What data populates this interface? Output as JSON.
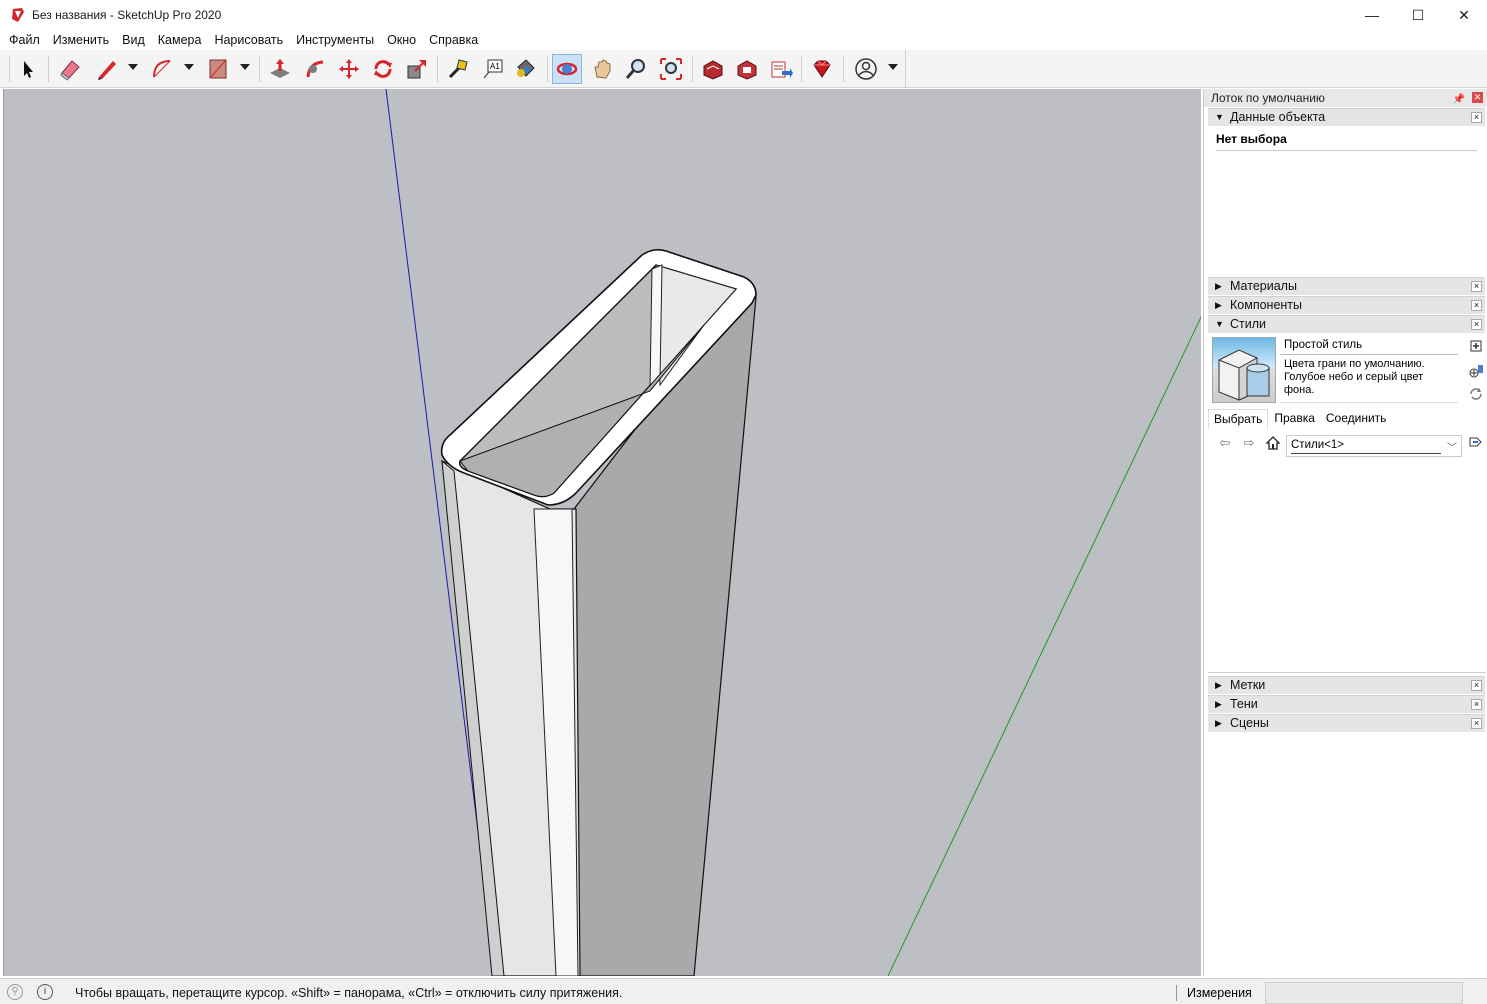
{
  "window": {
    "title": "Без названия - SketchUp Pro 2020",
    "minimize": "—",
    "maximize": "☐",
    "close": "✕"
  },
  "menu": [
    "Файл",
    "Изменить",
    "Вид",
    "Камера",
    "Нарисовать",
    "Инструменты",
    "Окно",
    "Справка"
  ],
  "toolbar": {
    "tools": [
      "select-icon",
      "eraser-icon",
      "pencil-icon",
      "arc-icon",
      "rectangle-icon",
      "push-pull-icon",
      "follow-me-icon",
      "move-icon",
      "rotate-icon",
      "scale-icon",
      "tape-measure-icon",
      "text-icon",
      "paint-bucket-icon",
      "orbit-icon",
      "pan-icon",
      "zoom-icon",
      "zoom-extents-icon",
      "warehouse-icon",
      "extension-warehouse-icon",
      "send-to-layout-icon",
      "ruby-icon",
      "account-icon"
    ],
    "active_tool": "orbit-icon"
  },
  "tray": {
    "title": "Лоток по умолчанию",
    "entity_info": {
      "header": "Данные объекта",
      "body": "Нет выбора"
    },
    "panels": {
      "materials": "Материалы",
      "components": "Компоненты",
      "styles": "Стили",
      "tags": "Метки",
      "shadows": "Тени",
      "scenes": "Сцены"
    },
    "styles": {
      "name": "Простой стиль",
      "description": "Цвета грани по умолчанию. Голубое небо и серый цвет фона.",
      "tabs": [
        "Выбрать",
        "Правка",
        "Соединить"
      ],
      "active_tab": "Выбрать",
      "collection": "Стили<1>"
    }
  },
  "status": {
    "hint": "Чтобы вращать, перетащите курсор. «Shift» = панорама, «Ctrl» = отключить силу притяжения.",
    "measurements_label": "Измерения",
    "measurements_value": ""
  },
  "colors": {
    "viewport_bg": "#bdbfc4",
    "axis_blue": "#1a1aa8",
    "axis_green": "#1f9a1f",
    "active_tool_bg": "#c9e0f7"
  }
}
